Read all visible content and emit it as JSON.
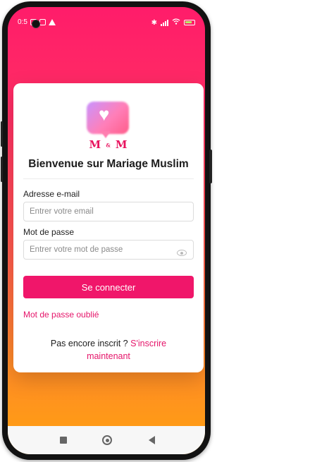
{
  "status_bar": {
    "time": "0:5"
  },
  "logo": {
    "letter_left": "M",
    "ampersand": "&",
    "letter_right": "M"
  },
  "login": {
    "title": "Bienvenue sur Mariage Muslim",
    "email_label": "Adresse e-mail",
    "email_placeholder": "Entrer votre email",
    "email_value": "",
    "password_label": "Mot de passe",
    "password_placeholder": "Entrer votre mot de passe",
    "password_value": "",
    "submit_label": "Se connecter",
    "forgot_label": "Mot de passe oublié",
    "signup_prompt": "Pas encore inscrit ?",
    "signup_link": "S'inscrire maintenant"
  },
  "colors": {
    "accent": "#f0166a",
    "gradient_top": "#ff1c6a",
    "gradient_bottom": "#ffa10f"
  },
  "icons": [
    "heart-icon",
    "eye-icon",
    "wifi-icon",
    "bluetooth-icon",
    "battery-icon",
    "signal-icon"
  ]
}
